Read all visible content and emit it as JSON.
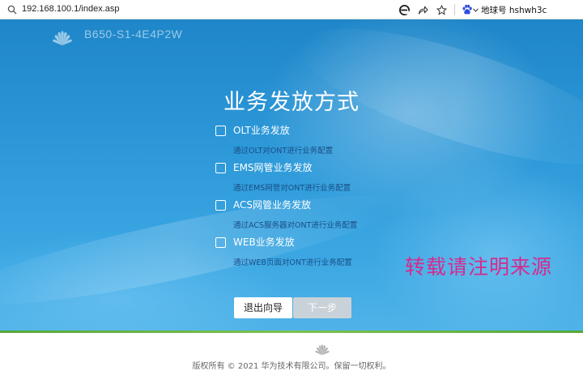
{
  "browser": {
    "url": "192.168.100.1/index.asp",
    "search_engine_label": "地球号 hshwh3c"
  },
  "header": {
    "model": "B650-S1-4E4P2W"
  },
  "main": {
    "title": "业务发放方式",
    "options": [
      {
        "label": "OLT业务发放",
        "desc": "通过OLT对ONT进行业务配置",
        "checked": false
      },
      {
        "label": "EMS网管业务发放",
        "desc": "通过EMS网管对ONT进行业务配置",
        "checked": false
      },
      {
        "label": "ACS网管业务发放",
        "desc": "通过ACS服务器对ONT进行业务配置",
        "checked": false
      },
      {
        "label": "WEB业务发放",
        "desc": "通过WEB页面对ONT进行业务配置",
        "checked": false
      }
    ],
    "exit_label": "退出向导",
    "next_label": "下一步"
  },
  "watermark": "转载请注明来源",
  "footer": {
    "copyright": "版权所有 © 2021 华为技术有限公司。保留一切权利。"
  },
  "colors": {
    "hero_top": "#1e86c9",
    "hero_bottom": "#4fb3e8",
    "desc_text": "#1a4e86",
    "watermark": "#d52a8e",
    "brand_green": "#56a83a",
    "disabled_button": "#c9d2d8"
  },
  "icons": [
    "search-icon",
    "edge-icon",
    "share-icon",
    "favorite-star-icon",
    "baidu-paw-icon",
    "huawei-logo-icon"
  ]
}
